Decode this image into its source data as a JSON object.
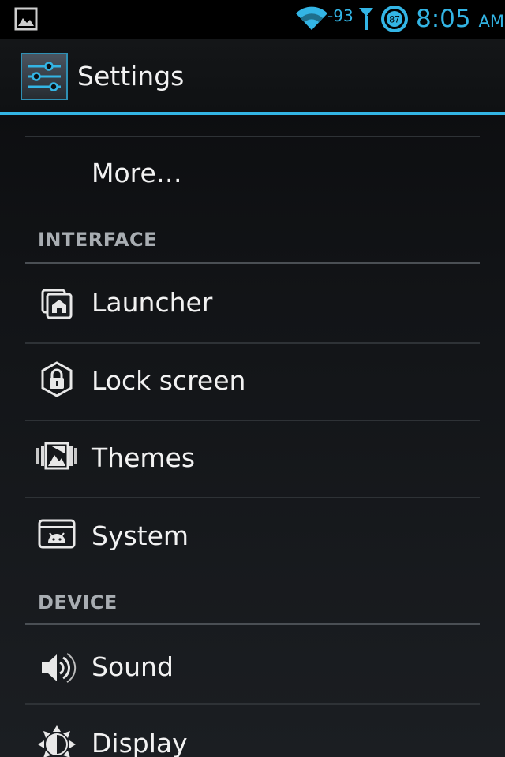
{
  "status_bar": {
    "notification_icon": "picture-icon",
    "wifi_icon": "wifi-icon",
    "signal_strength": "-93",
    "antenna_icon": "antenna-icon",
    "battery_level": "87",
    "time": "8:05",
    "ampm": "AM",
    "accent_color": "#33b5e5"
  },
  "action_bar": {
    "icon": "settings-sliders-icon",
    "title": "Settings"
  },
  "list": {
    "more_label": "More…",
    "sections": [
      {
        "header": "INTERFACE",
        "items": [
          {
            "label": "Launcher",
            "icon": "launcher-icon"
          },
          {
            "label": "Lock screen",
            "icon": "lock-icon"
          },
          {
            "label": "Themes",
            "icon": "themes-icon"
          },
          {
            "label": "System",
            "icon": "system-icon"
          }
        ]
      },
      {
        "header": "DEVICE",
        "items": [
          {
            "label": "Sound",
            "icon": "sound-icon"
          },
          {
            "label": "Display",
            "icon": "display-icon"
          }
        ]
      }
    ]
  }
}
